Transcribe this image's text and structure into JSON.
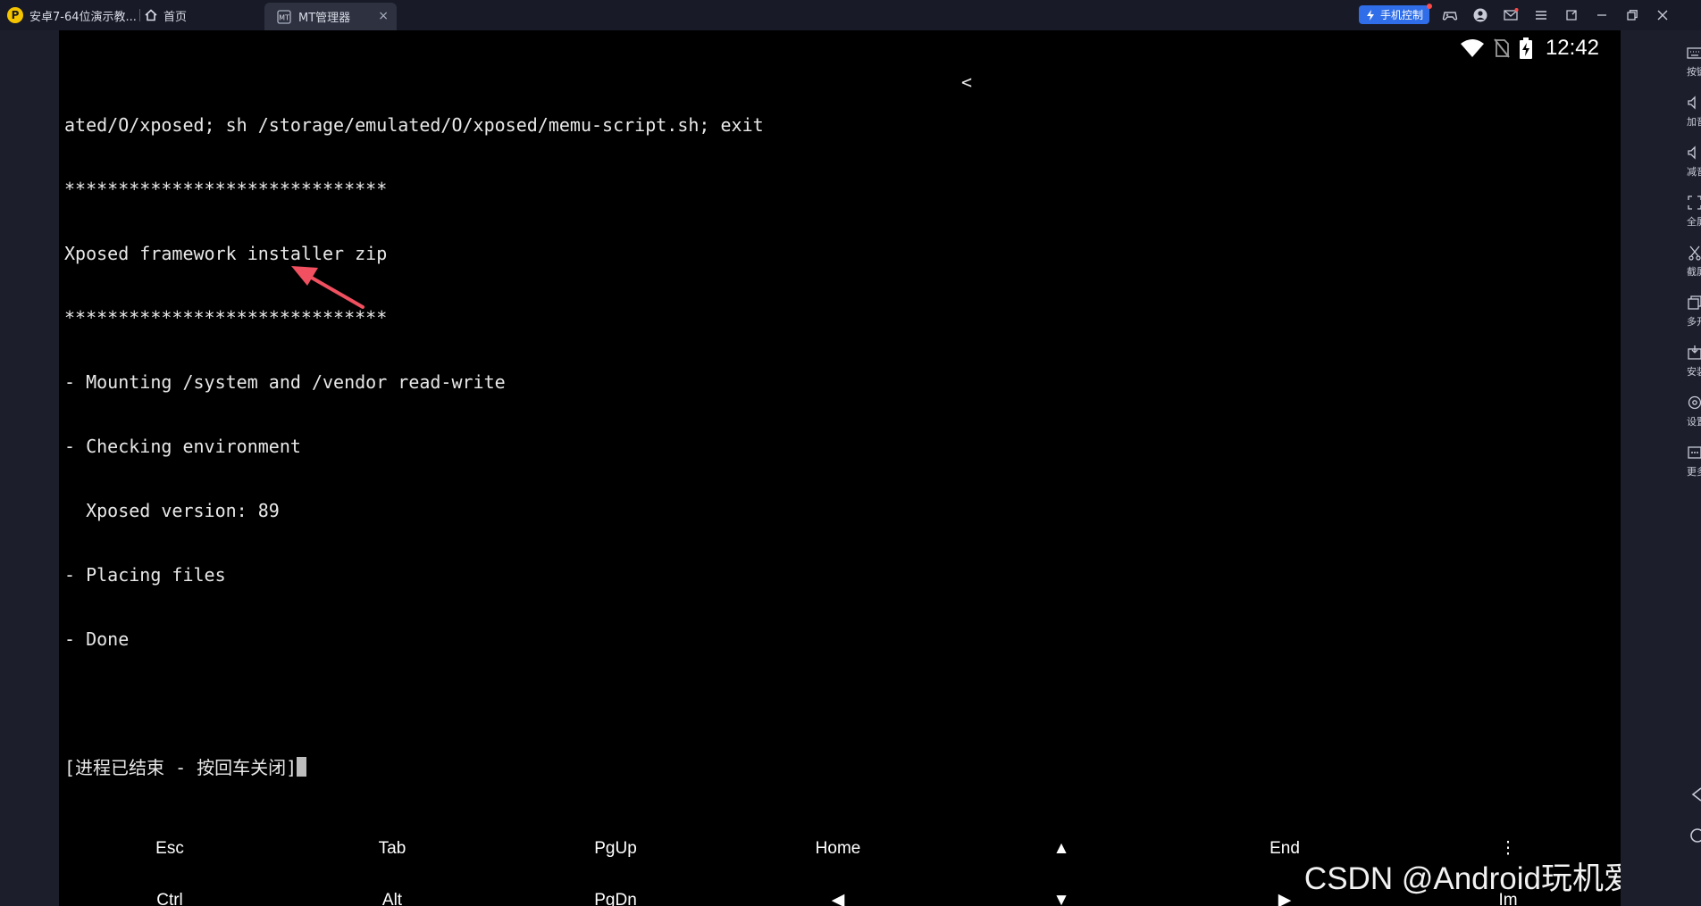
{
  "window": {
    "tabs": [
      {
        "label": "安卓7-64位演示教...",
        "icon": "emulator-logo-icon",
        "logo_char": "P"
      },
      {
        "label": "首页",
        "icon": "home-icon"
      },
      {
        "label": "MT管理器",
        "icon": "mt-manager-icon",
        "active": true,
        "close": "×"
      }
    ],
    "phone_control_label": "手机控制",
    "toolbar_icons": [
      "gamepad-icon",
      "user-icon",
      "mail-icon",
      "menu-icon",
      "pin-window-icon",
      "minimize-icon",
      "restore-icon",
      "close-icon"
    ]
  },
  "status_bar": {
    "time": "12:42",
    "icons": [
      "wifi-icon",
      "no-sim-icon",
      "battery-charging-icon"
    ]
  },
  "terminal": {
    "lines": [
      "ated/O/xposed; sh /storage/emulated/O/xposed/memu-script.sh; exit",
      "******************************",
      "Xposed framework installer zip",
      "******************************",
      "- Mounting /system and /vendor read-write",
      "- Checking environment",
      "  Xposed version: 89",
      "- Placing files",
      "- Done",
      "",
      "[进程已结束 - 按回车关闭]"
    ],
    "scroll_marker": "<"
  },
  "extra_keys": {
    "row1": [
      "Esc",
      "Tab",
      "PgUp",
      "Home",
      "▲",
      "End",
      "⋮"
    ],
    "row2": [
      "Ctrl",
      "Alt",
      "PgDn",
      "◀",
      "▼",
      "▶",
      "Im"
    ]
  },
  "sidebar": {
    "items": [
      {
        "label": "按键",
        "icon": "keyboard-icon"
      },
      {
        "label": "加音",
        "icon": "volume-up-icon"
      },
      {
        "label": "减音",
        "icon": "volume-down-icon"
      },
      {
        "label": "全屏",
        "icon": "fullscreen-icon"
      },
      {
        "label": "截屏",
        "icon": "screenshot-icon"
      },
      {
        "label": "多开",
        "icon": "multi-instance-icon"
      },
      {
        "label": "安装",
        "icon": "install-apk-icon"
      },
      {
        "label": "设置",
        "icon": "settings-icon"
      },
      {
        "label": "更多",
        "icon": "more-icon"
      }
    ],
    "nav": [
      "back-icon",
      "home-circle-icon"
    ]
  },
  "watermark": "CSDN @Android玩机爱好者",
  "colors": {
    "accent": "#2f6ee8",
    "terminal_bg": "#000000",
    "annotation_arrow": "#f0505f"
  }
}
